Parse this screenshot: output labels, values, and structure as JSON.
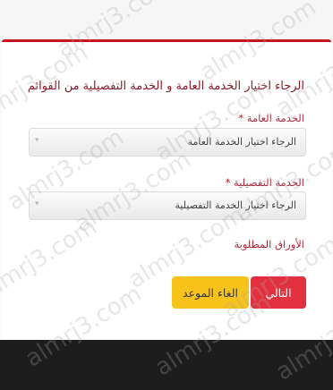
{
  "form": {
    "title": "الرجاء اختيار الخدمة العامة و الخدمة التفصيلية من القوائم",
    "general_service": {
      "label": "الخدمة العامة",
      "required_mark": "*",
      "placeholder": "الرجاء اختيار الخدمة العامة"
    },
    "detailed_service": {
      "label": "الخدمة التفصيلية",
      "required_mark": "*",
      "placeholder": "الرجاء اختيار الخدمة التفصيلية"
    },
    "required_documents_label": "الأوراق المطلوبة",
    "next_button": "التالي",
    "cancel_button": "الغاء الموعد"
  },
  "watermark": {
    "text": "almrj3.com"
  },
  "colors": {
    "accent": "#c5161d",
    "next_button_bg": "#e2303e",
    "cancel_button_bg": "#f7c21a",
    "label_color": "#b0283a"
  }
}
